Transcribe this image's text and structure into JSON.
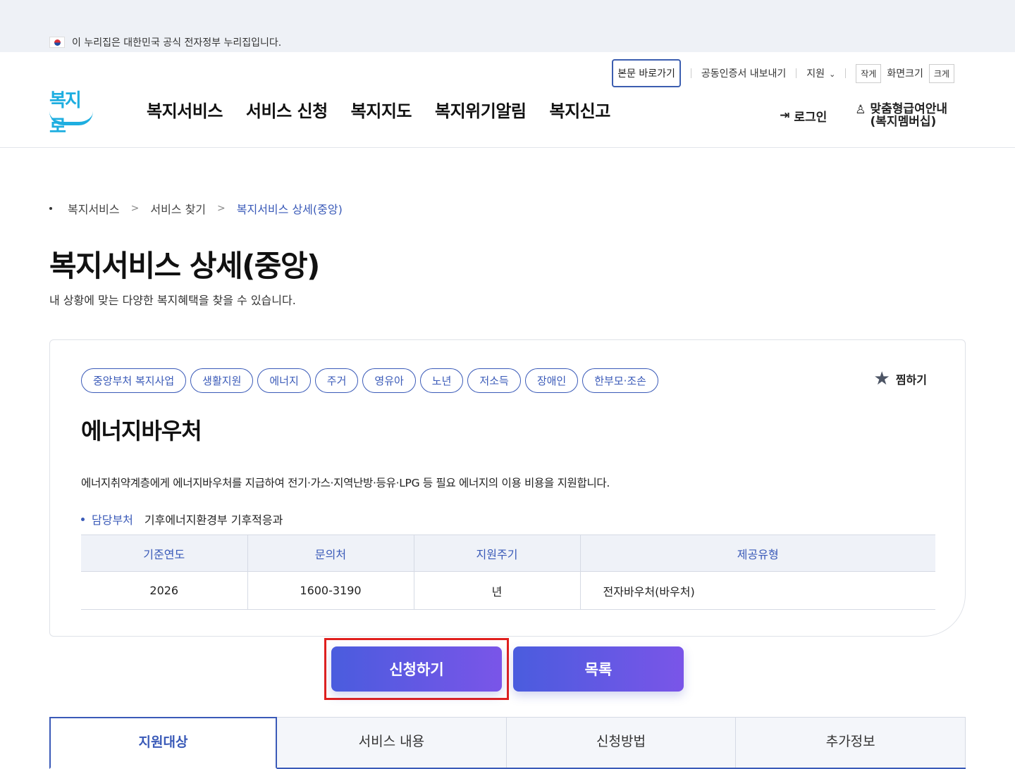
{
  "gov_banner": {
    "text": "이 누리집은 대한민국 공식 전자정부 누리집입니다."
  },
  "header": {
    "logo_text": "복지로",
    "util": {
      "skip": "본문 바로가기",
      "cert": "공동인증서 내보내기",
      "support": "지원",
      "font_small": "작게",
      "font_label": "화면크기",
      "font_large": "크게"
    },
    "nav": [
      "복지서비스",
      "서비스 신청",
      "복지지도",
      "복지위기알림",
      "복지신고"
    ],
    "login": "로그인",
    "member_line1": "맞춤형급여안내",
    "member_line2": "(복지멤버십)"
  },
  "breadcrumb": [
    "복지서비스",
    "서비스 찾기",
    "복지서비스 상세(중앙)"
  ],
  "page": {
    "title": "복지서비스 상세(중앙)",
    "subtitle": "내 상황에 맞는 다양한 복지혜택을 찾을 수 있습니다."
  },
  "card": {
    "tags": [
      "중앙부처 복지사업",
      "생활지원",
      "에너지",
      "주거",
      "영유아",
      "노년",
      "저소득",
      "장애인",
      "한부모·조손"
    ],
    "favorite": "찜하기",
    "service_title": "에너지바우처",
    "description": "에너지취약계층에게 에너지바우처를 지급하여 전기·가스·지역난방·등유·LPG 등 필요 에너지의 이용 비용을 지원합니다.",
    "dept_label": "담당부처",
    "dept_value": "기후에너지환경부 기후적응과",
    "table": {
      "headers": [
        "기준연도",
        "문의처",
        "지원주기",
        "제공유형"
      ],
      "row": [
        "2026",
        "1600-3190",
        "년",
        "전자바우처(바우처)"
      ]
    }
  },
  "buttons": {
    "apply": "신청하기",
    "list": "목록"
  },
  "tabs": [
    "지원대상",
    "서비스 내용",
    "신청방법",
    "추가정보"
  ]
}
